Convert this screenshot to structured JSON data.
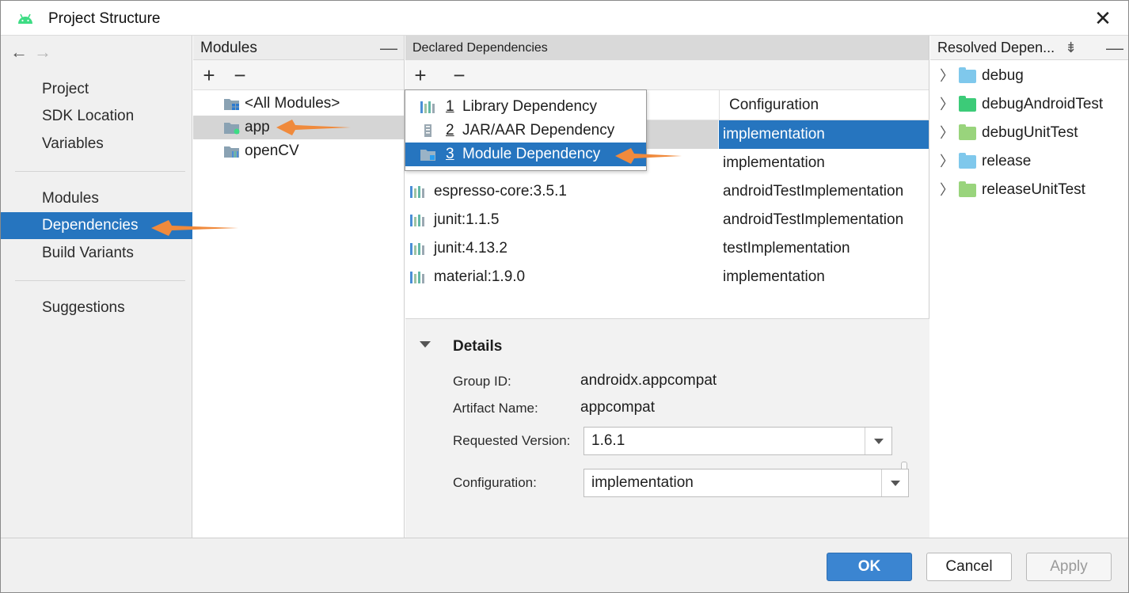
{
  "window": {
    "title": "Project Structure"
  },
  "sidebar": {
    "items": [
      {
        "label": "Project"
      },
      {
        "label": "SDK Location"
      },
      {
        "label": "Variables"
      },
      {
        "label": "Modules"
      },
      {
        "label": "Dependencies",
        "selected": true
      },
      {
        "label": "Build Variants"
      },
      {
        "label": "Suggestions"
      }
    ]
  },
  "modules": {
    "header": "Modules",
    "items": [
      {
        "label": "<All Modules>"
      },
      {
        "label": "app",
        "selected": true
      },
      {
        "label": "openCV"
      }
    ]
  },
  "declared": {
    "header": "Declared Dependencies",
    "config_header": "Configuration",
    "rows": [
      {
        "name": "",
        "config": "implementation",
        "selected": true
      },
      {
        "name": "",
        "config": "implementation"
      },
      {
        "name": "espresso-core:3.5.1",
        "config": "androidTestImplementation"
      },
      {
        "name": "junit:1.1.5",
        "config": "androidTestImplementation"
      },
      {
        "name": "junit:4.13.2",
        "config": "testImplementation"
      },
      {
        "name": "material:1.9.0",
        "config": "implementation"
      }
    ]
  },
  "popup_menu": {
    "items": [
      {
        "num": "1",
        "label": "Library Dependency"
      },
      {
        "num": "2",
        "label": "JAR/AAR Dependency"
      },
      {
        "num": "3",
        "label": "Module Dependency",
        "selected": true
      }
    ]
  },
  "details": {
    "title": "Details",
    "group_id_label": "Group ID:",
    "group_id": "androidx.appcompat",
    "artifact_label": "Artifact Name:",
    "artifact": "appcompat",
    "version_label": "Requested Version:",
    "version": "1.6.1",
    "config_label": "Configuration:",
    "config": "implementation"
  },
  "resolved": {
    "header": "Resolved Depen...",
    "items": [
      {
        "label": "debug",
        "color": "#7fc8ec"
      },
      {
        "label": "debugAndroidTest",
        "color": "#3ccb78"
      },
      {
        "label": "debugUnitTest",
        "color": "#99d47c"
      },
      {
        "label": "release",
        "color": "#7fc8ec"
      },
      {
        "label": "releaseUnitTest",
        "color": "#99d47c"
      }
    ]
  },
  "buttons": {
    "ok": "OK",
    "cancel": "Cancel",
    "apply": "Apply"
  },
  "colors": {
    "selection": "#2675bf",
    "annotation_arrow": "#f08a3c",
    "android_logo": "#3ddc84"
  }
}
